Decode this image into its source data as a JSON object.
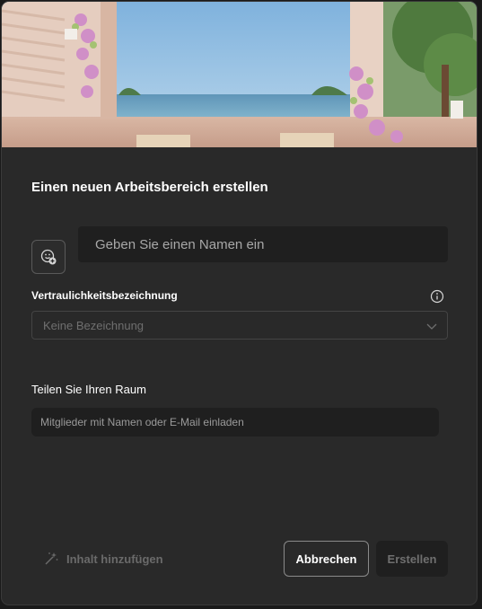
{
  "dialog": {
    "title": "Einen neuen Arbeitsbereich erstellen",
    "hero_image": "terrace-sea-view-illustration",
    "workspace_icon": "add-emoji-icon",
    "name_input": {
      "value": "",
      "placeholder": "Geben Sie einen Namen ein"
    },
    "sensitivity": {
      "label": "Vertraulichkeitsbezeichnung",
      "info_icon": "info-icon",
      "selected": "Keine Bezeichnung",
      "dropdown_icon": "chevron-down-icon"
    },
    "share": {
      "label": "Teilen Sie Ihren Raum",
      "invite_placeholder": "Mitglieder mit Namen oder E-Mail einladen"
    },
    "footer": {
      "add_content_label": "Inhalt hinzufügen",
      "add_content_icon": "magic-wand-icon",
      "cancel_label": "Abbrechen",
      "create_label": "Erstellen"
    }
  },
  "colors": {
    "dialog_bg": "#292929",
    "input_bg": "#1f1f1f",
    "text_primary": "#ffffff",
    "text_muted": "#6f6f6f"
  }
}
